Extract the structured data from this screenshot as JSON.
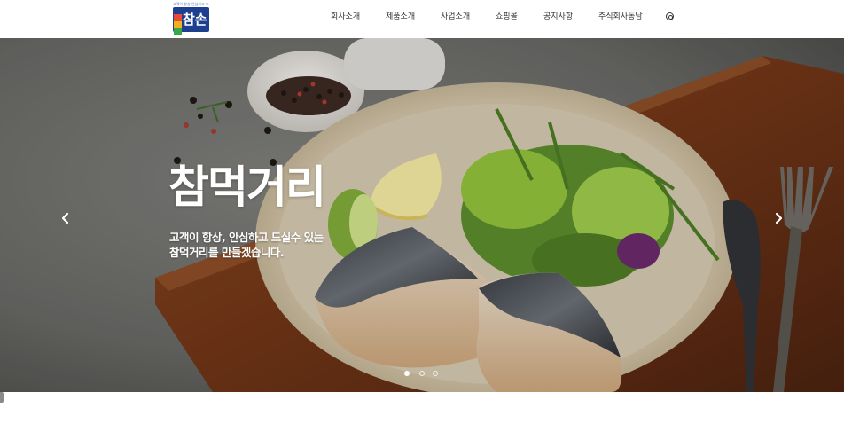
{
  "header": {
    "logo": {
      "top_text": "고객이 항상 안심하고 드실수 있는",
      "brand": "참손"
    },
    "nav": [
      {
        "label": "회사소개"
      },
      {
        "label": "제품소개"
      },
      {
        "label": "사업소개"
      },
      {
        "label": "쇼핑몰"
      },
      {
        "label": "공지사항"
      },
      {
        "label": "주식회사동남"
      }
    ],
    "user_icon": "user-icon"
  },
  "hero": {
    "title": "참먹거리",
    "subtitle_line1": "고객이 항상, 안심하고 드실수 있는",
    "subtitle_line2": "참먹거리를 만들겠습니다.",
    "prev_icon": "chevron-left-icon",
    "next_icon": "chevron-right-icon",
    "slides": [
      {
        "active": true
      },
      {
        "active": false
      },
      {
        "active": false
      }
    ]
  },
  "colors": {
    "logo_blue": "#1e3f8f",
    "nav_text": "#333333",
    "hero_text": "#ffffff"
  }
}
